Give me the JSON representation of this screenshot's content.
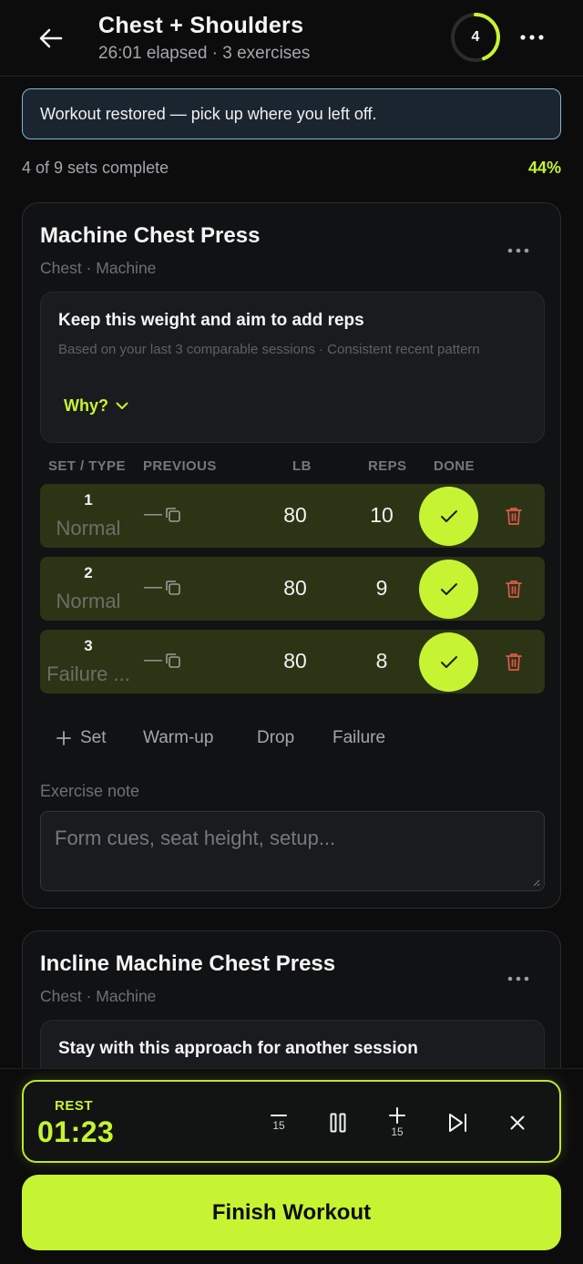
{
  "header": {
    "title": "Chest + Shoulders",
    "subtitle": "26:01 elapsed · 3 exercises",
    "ring_value": "4",
    "ring_fraction": 0.44
  },
  "banner": {
    "text": "Workout restored — pick up where you left off."
  },
  "progress": {
    "text": "4 of 9 sets complete",
    "percent": "44%"
  },
  "columns": {
    "set_type": "SET / TYPE",
    "previous": "PREVIOUS",
    "lb": "LB",
    "reps": "REPS",
    "done": "DONE"
  },
  "exercises": [
    {
      "name": "Machine Chest Press",
      "meta": "Chest · Machine",
      "recommendation": {
        "title": "Keep this weight and aim to add reps",
        "subtitle": "Based on your last 3 comparable sessions · Consistent recent pattern",
        "why_label": "Why?"
      },
      "sets": [
        {
          "number": "1",
          "type": "Normal",
          "previous": "—",
          "lb": "80",
          "reps": "10"
        },
        {
          "number": "2",
          "type": "Normal",
          "previous": "—",
          "lb": "80",
          "reps": "9"
        },
        {
          "number": "3",
          "type": "Failure ...",
          "previous": "—",
          "lb": "80",
          "reps": "8"
        }
      ],
      "add_buttons": {
        "set": "Set",
        "warmup": "Warm-up",
        "drop": "Drop",
        "failure": "Failure"
      },
      "note_label": "Exercise note",
      "note_placeholder": "Form cues, seat height, setup..."
    },
    {
      "name": "Incline Machine Chest Press",
      "meta": "Chest · Machine",
      "recommendation": {
        "title": "Stay with this approach for another session"
      }
    }
  ],
  "rest_timer": {
    "label": "REST",
    "time": "01:23",
    "minus_label": "15",
    "plus_label": "15"
  },
  "finish_label": "Finish Workout",
  "colors": {
    "accent": "#c6f432",
    "background": "#0c0c0d",
    "done_row": "#2c3416",
    "trash": "#e0584a",
    "banner_border": "#7fb6d6"
  }
}
